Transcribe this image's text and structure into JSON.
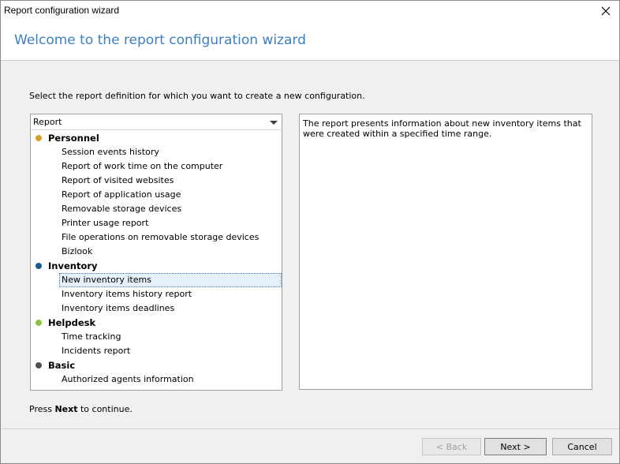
{
  "window": {
    "title": "Report configuration wizard"
  },
  "header": {
    "title": "Welcome to the report configuration wizard"
  },
  "instruction": "Select the report definition for which you want to create a new configuration.",
  "list": {
    "column_header": "Report",
    "groups": [
      {
        "label": "Personnel",
        "dot_color": "#d4a030",
        "items": [
          "Session events history",
          "Report of work time on the computer",
          "Report of visited websites",
          "Report of application usage",
          "Removable storage devices",
          "Printer usage report",
          "File operations on removable storage devices",
          "Bizlook"
        ]
      },
      {
        "label": "Inventory",
        "dot_color": "#1e5a90",
        "items": [
          "New inventory items",
          "Inventory items history report",
          "Inventory items deadlines"
        ]
      },
      {
        "label": "Helpdesk",
        "dot_color": "#8cc43c",
        "items": [
          "Time tracking",
          "Incidents report"
        ]
      },
      {
        "label": "Basic",
        "dot_color": "#505050",
        "items": [
          "Authorized agents information"
        ]
      }
    ],
    "selected_item": "New inventory items"
  },
  "description": "The report presents information about new inventory items that were created within a specified time range.",
  "footer": {
    "press_prefix": "Press ",
    "press_bold": "Next",
    "press_suffix": " to continue.",
    "back_label": "< Back",
    "next_label": "Next >",
    "cancel_label": "Cancel"
  }
}
